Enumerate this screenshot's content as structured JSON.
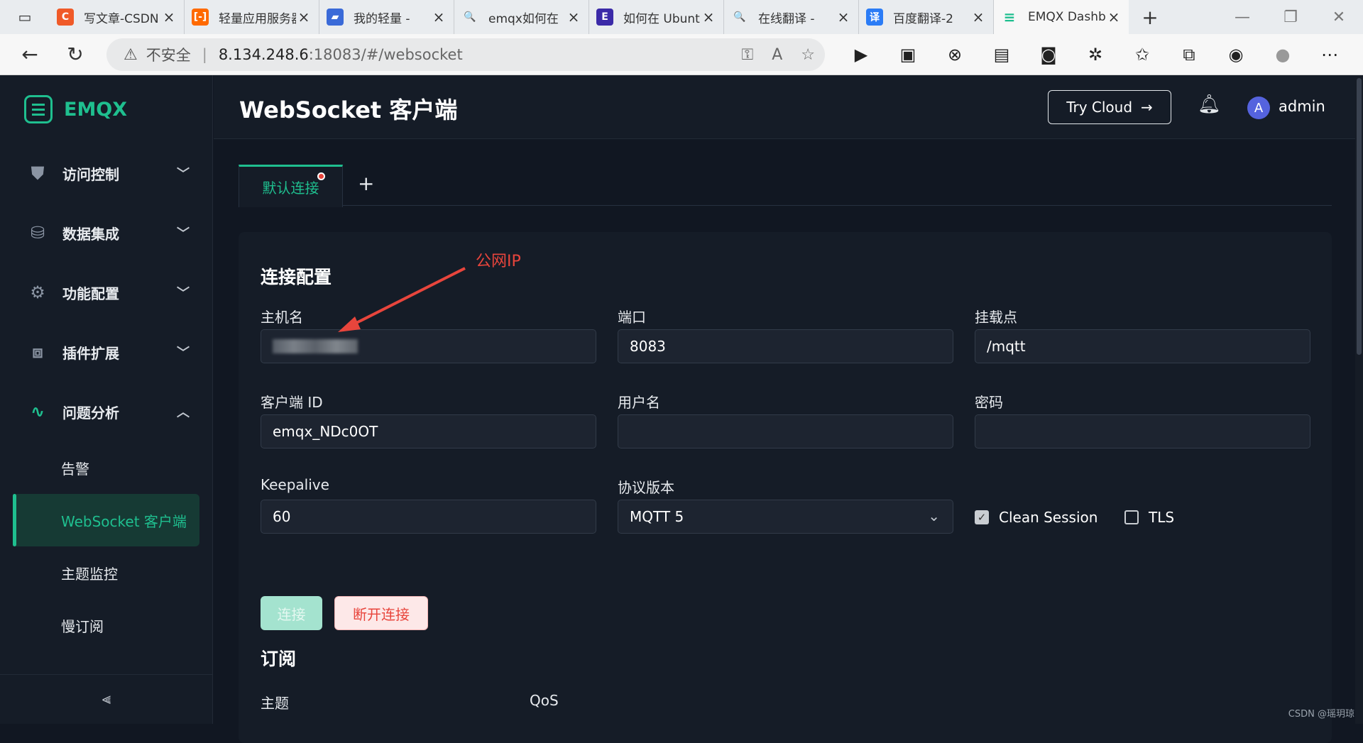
{
  "browser": {
    "tabs": [
      {
        "label": "写文章-CSDN",
        "icon": "csdn-icon",
        "icon_char": "C",
        "icon_color": "#f05a28"
      },
      {
        "label": "轻量应用服务器",
        "icon": "aliyun-icon",
        "icon_char": "[-]",
        "icon_color": "#ff6a00"
      },
      {
        "label": "我的轻量 -",
        "icon": "server-icon",
        "icon_char": "▰",
        "icon_color": "#3a6ad8"
      },
      {
        "label": "emqx如何在",
        "icon": "search-icon",
        "icon_char": "🔍",
        "icon_color": "#e9ecef"
      },
      {
        "label": "如何在 Ubuntu",
        "icon": "doc-icon",
        "icon_char": "E",
        "icon_color": "#3b2aa8"
      },
      {
        "label": "在线翻译 -",
        "icon": "search-icon",
        "icon_char": "🔍",
        "icon_color": "#e9ecef"
      },
      {
        "label": "百度翻译-2",
        "icon": "translate-icon",
        "icon_char": "译",
        "icon_color": "#2b7cf6"
      },
      {
        "label": "EMQX Dashboard",
        "icon": "emqx-icon",
        "icon_char": "≡",
        "icon_color": "#1fbf8f"
      }
    ],
    "new_tab": "+",
    "address": {
      "insecure_label": "不安全",
      "host": "8.134.248.6",
      "path": ":18083/#/websocket"
    }
  },
  "app": {
    "logo": "EMQX",
    "menu": [
      {
        "label": "访问控制",
        "icon": "shield-icon",
        "expanded": false
      },
      {
        "label": "数据集成",
        "icon": "database-icon",
        "expanded": false
      },
      {
        "label": "功能配置",
        "icon": "gear-icon",
        "expanded": false
      },
      {
        "label": "插件扩展",
        "icon": "puzzle-icon",
        "expanded": false
      },
      {
        "label": "问题分析",
        "icon": "analysis-icon",
        "expanded": true
      }
    ],
    "submenu": [
      "告警",
      "WebSocket 客户端",
      "主题监控",
      "慢订阅"
    ],
    "active_submenu": "WebSocket 客户端",
    "collapse_icon": "collapse-icon"
  },
  "header": {
    "title": "WebSocket 客户端",
    "try_cloud": "Try Cloud",
    "user_initial": "A",
    "user_name": "admin"
  },
  "tabs": {
    "current": "默认连接",
    "add": "+"
  },
  "connection": {
    "section_title": "连接配置",
    "host_label": "主机名",
    "host_value": "",
    "port_label": "端口",
    "port_value": "8083",
    "mount_label": "挂载点",
    "mount_value": "/mqtt",
    "client_id_label": "客户端 ID",
    "client_id_value": "emqx_NDc0OT",
    "username_label": "用户名",
    "username_value": "",
    "password_label": "密码",
    "password_value": "",
    "keepalive_label": "Keepalive",
    "keepalive_value": "60",
    "protocol_label": "协议版本",
    "protocol_value": "MQTT 5",
    "clean_session_label": "Clean Session",
    "clean_session": true,
    "tls_label": "TLS",
    "tls": false,
    "connect_button": "连接",
    "disconnect_button": "断开连接"
  },
  "subscribe": {
    "section_title": "订阅",
    "topic_label": "主题",
    "qos_label": "QoS"
  },
  "annotation": {
    "text": "公网IP",
    "color": "#e8453c"
  },
  "watermark": "CSDN @瑶玥琼"
}
